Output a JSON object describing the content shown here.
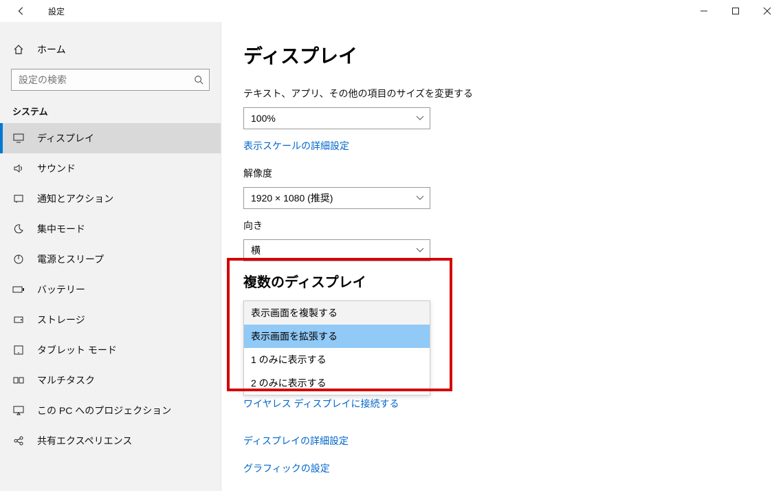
{
  "titlebar": {
    "title": "設定"
  },
  "sidebar": {
    "home": "ホーム",
    "search_placeholder": "設定の検索",
    "section": "システム",
    "items": [
      {
        "label": "ディスプレイ"
      },
      {
        "label": "サウンド"
      },
      {
        "label": "通知とアクション"
      },
      {
        "label": "集中モード"
      },
      {
        "label": "電源とスリープ"
      },
      {
        "label": "バッテリー"
      },
      {
        "label": "ストレージ"
      },
      {
        "label": "タブレット モード"
      },
      {
        "label": "マルチタスク"
      },
      {
        "label": "この PC へのプロジェクション"
      },
      {
        "label": "共有エクスペリエンス"
      }
    ]
  },
  "main": {
    "page_title": "ディスプレイ",
    "scale_label": "テキスト、アプリ、その他の項目のサイズを変更する",
    "scale_value": "100%",
    "advanced_scale_link": "表示スケールの詳細設定",
    "resolution_label": "解像度",
    "resolution_value": "1920 × 1080 (推奨)",
    "orientation_label": "向き",
    "orientation_value": "横",
    "multi_heading": "複数のディスプレイ",
    "multi_options": [
      "表示画面を複製する",
      "表示画面を拡張する",
      "1 のみに表示する",
      "2 のみに表示する"
    ],
    "wireless_link": "ワイヤレス ディスプレイに接続する",
    "advanced_display_link": "ディスプレイの詳細設定",
    "graphics_link": "グラフィックの設定"
  }
}
